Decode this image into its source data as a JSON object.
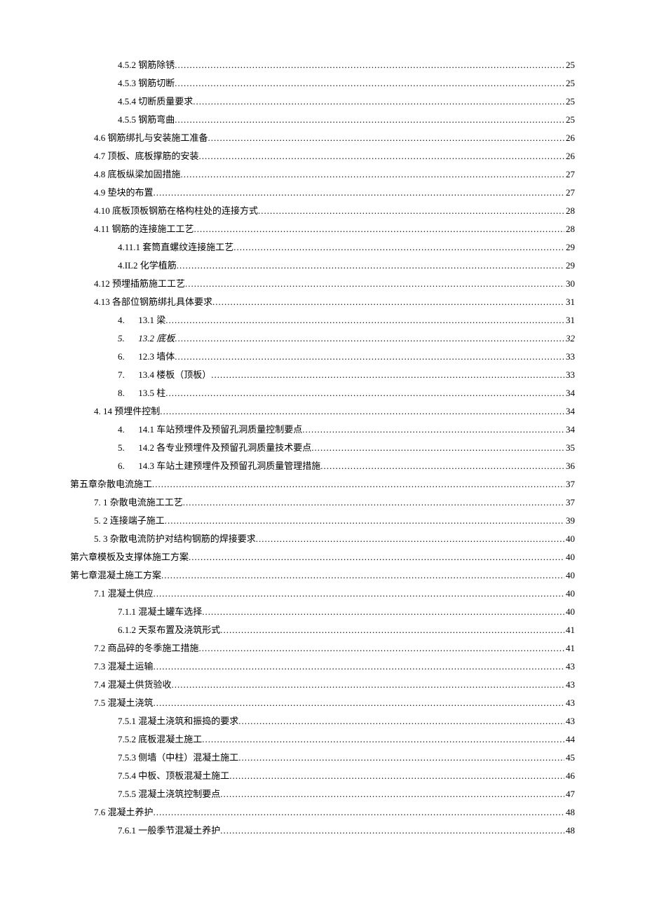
{
  "toc": [
    {
      "level": "lvl3",
      "label": "4.5.2 钢筋除锈",
      "page": "25"
    },
    {
      "level": "lvl3",
      "label": "4.5.3 钢筋切断",
      "page": "25"
    },
    {
      "level": "lvl3",
      "label": "4.5.4 切断质量要求",
      "page": "25"
    },
    {
      "level": "lvl3",
      "label": "4.5.5 钢筋弯曲",
      "page": "25"
    },
    {
      "level": "lvl2",
      "label": "4.6 钢筋绑扎与安装施工准备",
      "page": "26"
    },
    {
      "level": "lvl2",
      "label": "4.7 顶板、底板撑筋的安装",
      "page": "26"
    },
    {
      "level": "lvl2",
      "label": "4.8 底板纵梁加固措施",
      "page": "27"
    },
    {
      "level": "lvl2",
      "label": "4.9 垫块的布置",
      "page": "27"
    },
    {
      "level": "lvl2",
      "label": "4.10 底板顶板钢筋在格构柱处的连接方式",
      "page": "28"
    },
    {
      "level": "lvl2",
      "label": "4.11 钢筋的连接施工工艺",
      "page": "28"
    },
    {
      "level": "lvl3",
      "label": "4.11.1 套筒直螺纹连接施工艺",
      "page": "29"
    },
    {
      "level": "lvl3",
      "label": "4.IL2 化学植筋",
      "page": "29"
    },
    {
      "level": "lvl2",
      "label": "4.12 预埋插筋施工工艺",
      "page": "30"
    },
    {
      "level": "lvl2",
      "label": "4.13 各部位钢筋绑扎具体要求",
      "page": "31"
    },
    {
      "level": "lvl3n",
      "num": "4.",
      "label": "13.1 梁",
      "page": "31"
    },
    {
      "level": "lvl3n",
      "num": "5.",
      "label": "13.2 底板",
      "page": "32",
      "italic": true
    },
    {
      "level": "lvl3n",
      "num": "6.",
      "label": "12.3 墙体",
      "page": "33"
    },
    {
      "level": "lvl3n",
      "num": "7.",
      "label": "13.4 楼板（顶板）",
      "page": "33"
    },
    {
      "level": "lvl3n",
      "num": "8.",
      "label": "13.5 柱",
      "page": "34"
    },
    {
      "level": "lvl2n",
      "num": "4.",
      "label": "14 预埋件控制",
      "page": "34"
    },
    {
      "level": "lvl3n",
      "num": "4.",
      "label": "14.1 车站预埋件及预留孔洞质量控制要点",
      "page": "34"
    },
    {
      "level": "lvl3n",
      "num": "5.",
      "label": "14.2 各专业预埋件及预留孔洞质量技术要点",
      "page": "35"
    },
    {
      "level": "lvl3n",
      "num": "6.",
      "label": "14.3 车站土建预埋件及预留孔洞质量管理措施",
      "page": "36"
    },
    {
      "level": "lvl1",
      "label": "第五章杂散电流施工",
      "page": "37"
    },
    {
      "level": "lvl2n",
      "num": "7.",
      "label": "1 杂散电流施工工艺",
      "page": "37"
    },
    {
      "level": "lvl2n",
      "num": "5.",
      "label": "2 连接端子施工",
      "page": "39"
    },
    {
      "level": "lvl2n",
      "num": "5.",
      "label": "3 杂散电流防护对结构钢筋的焊接要求",
      "page": "40"
    },
    {
      "level": "lvl1",
      "label": "第六章模板及支撑体施工方案",
      "page": "40"
    },
    {
      "level": "lvl1",
      "label": "第七章混凝土施工方案",
      "page": "40"
    },
    {
      "level": "lvl2",
      "label": "7.1 混凝土供应",
      "page": "40"
    },
    {
      "level": "lvl3",
      "label": "7.1.1 混凝土罐车选择",
      "page": "40"
    },
    {
      "level": "lvl3",
      "label": "6.1.2 天泵布置及浇筑形式",
      "page": "41"
    },
    {
      "level": "lvl2",
      "label": "7.2 商品碎的冬季施工措施",
      "page": "41"
    },
    {
      "level": "lvl2",
      "label": "7.3 混凝土运输",
      "page": "43"
    },
    {
      "level": "lvl2",
      "label": "7.4 混凝土供货验收",
      "page": "43"
    },
    {
      "level": "lvl2",
      "label": "7.5 混凝土浇筑",
      "page": "43"
    },
    {
      "level": "lvl3",
      "label": "7.5.1 混凝土浇筑和振捣的要求",
      "page": "43"
    },
    {
      "level": "lvl3",
      "label": "7.5.2 底板混凝土施工",
      "page": "44"
    },
    {
      "level": "lvl3",
      "label": "7.5.3 侧墙（中柱）混凝土施工",
      "page": "45"
    },
    {
      "level": "lvl3",
      "label": "7.5.4 中板、顶板混凝土施工",
      "page": "46"
    },
    {
      "level": "lvl3",
      "label": "7.5.5 混凝土浇筑控制要点",
      "page": "47"
    },
    {
      "level": "lvl2",
      "label": "7.6 混凝土养护",
      "page": "48"
    },
    {
      "level": "lvl3",
      "label": "7.6.1 一般季节混凝土养护",
      "page": "48"
    }
  ]
}
